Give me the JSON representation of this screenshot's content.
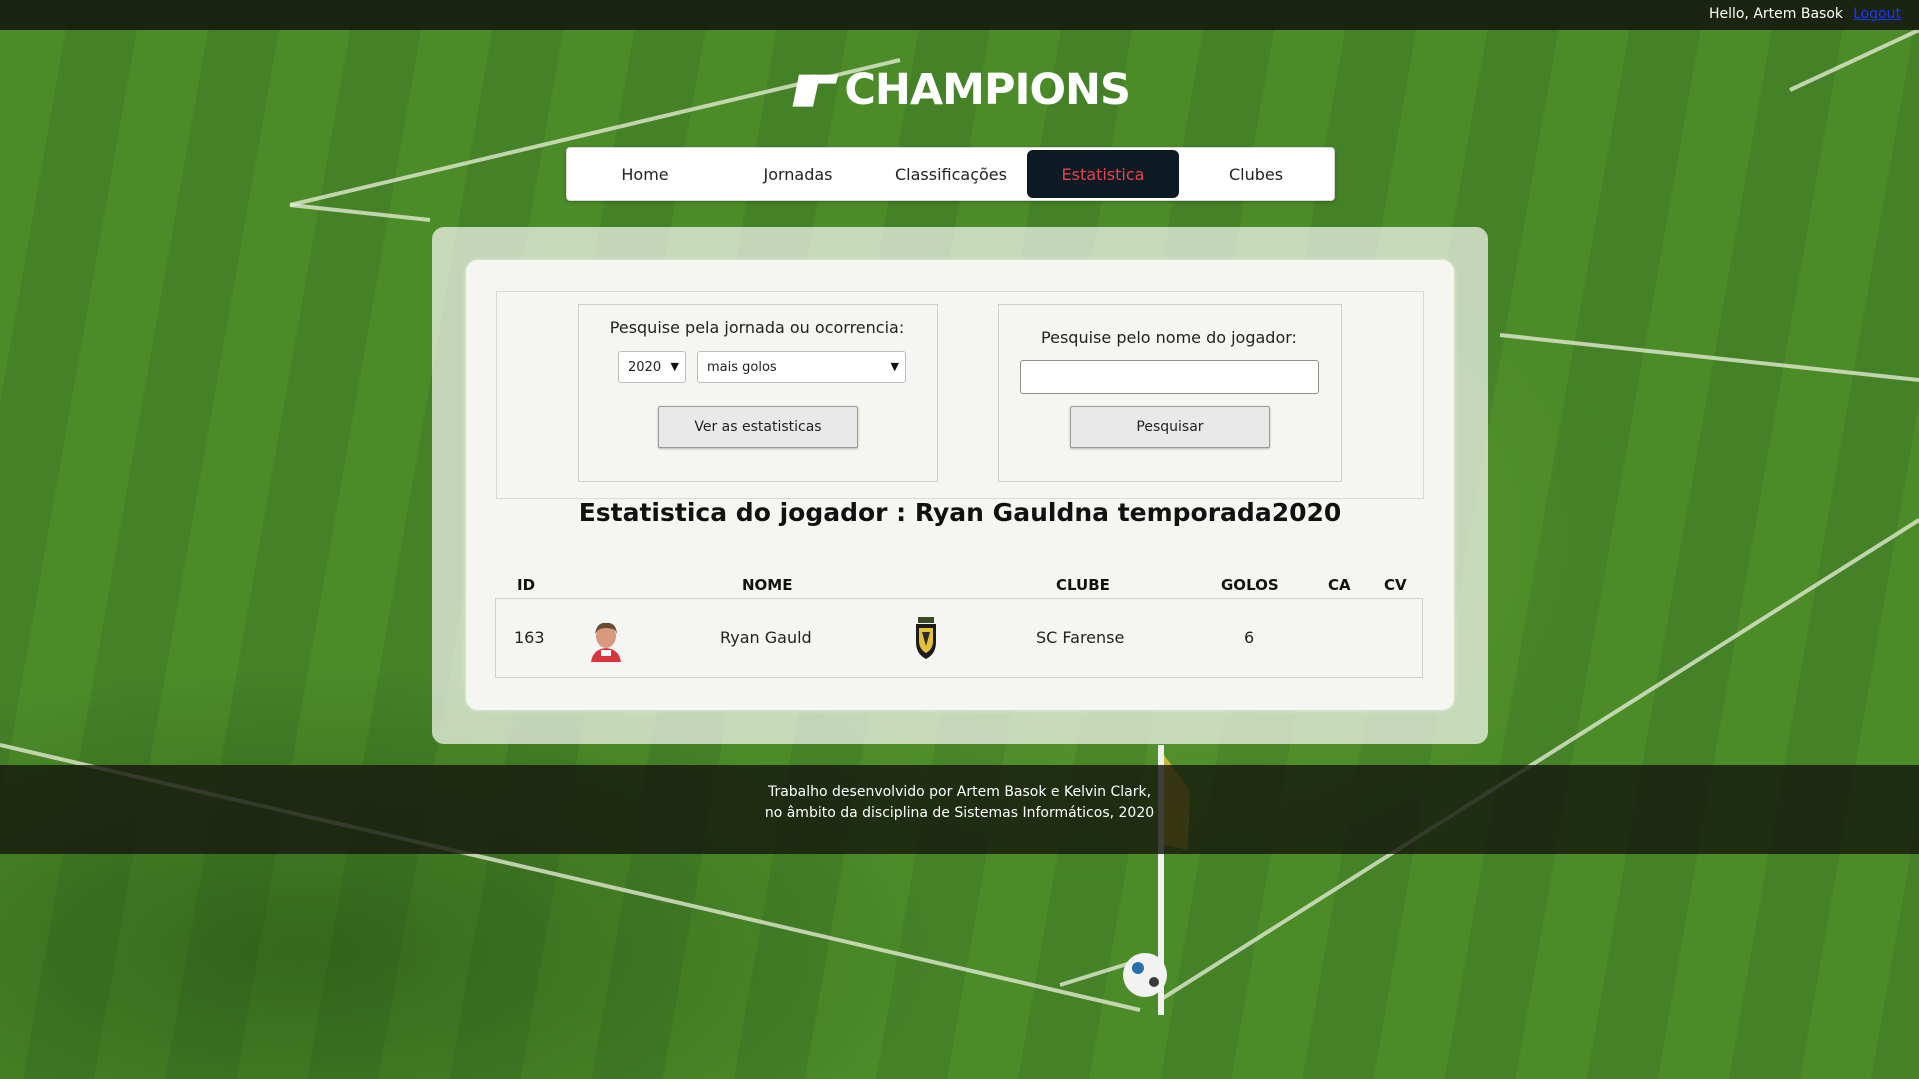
{
  "topbar": {
    "greeting": "Hello, Artem Basok",
    "logout": "Logout"
  },
  "brand": {
    "name": "CHAMPIONS"
  },
  "nav": {
    "items": [
      {
        "label": "Home"
      },
      {
        "label": "Jornadas"
      },
      {
        "label": "Classificações"
      },
      {
        "label": "Estatistica",
        "active": true
      },
      {
        "label": "Clubes"
      }
    ]
  },
  "search_round": {
    "label": "Pesquise pela jornada ou ocorrencia:",
    "year_value": "2020",
    "filter_value": "mais golos",
    "button": "Ver as estatisticas"
  },
  "search_player": {
    "label": "Pesquise pelo nome do jogador:",
    "input_value": "",
    "button": "Pesquisar"
  },
  "stats": {
    "title": "Estatistica do jogador : Ryan Gauldna temporada2020",
    "columns": [
      "ID",
      "NOME",
      "CLUBE",
      "GOLOS",
      "CA",
      "CV"
    ],
    "row": {
      "id": "163",
      "name": "Ryan Gauld",
      "club": "SC Farense",
      "goals": "6",
      "ca": "",
      "cv": ""
    }
  },
  "footer": {
    "line1": "Trabalho desenvolvido por Artem Basok e Kelvin Clark,",
    "line2": "no âmbito da disciplina de Sistemas Informáticos, 2020"
  },
  "colors": {
    "nav_active_bg": "#0d1a24",
    "nav_active_text": "#e8424e",
    "logout_link": "#1a35ff"
  }
}
